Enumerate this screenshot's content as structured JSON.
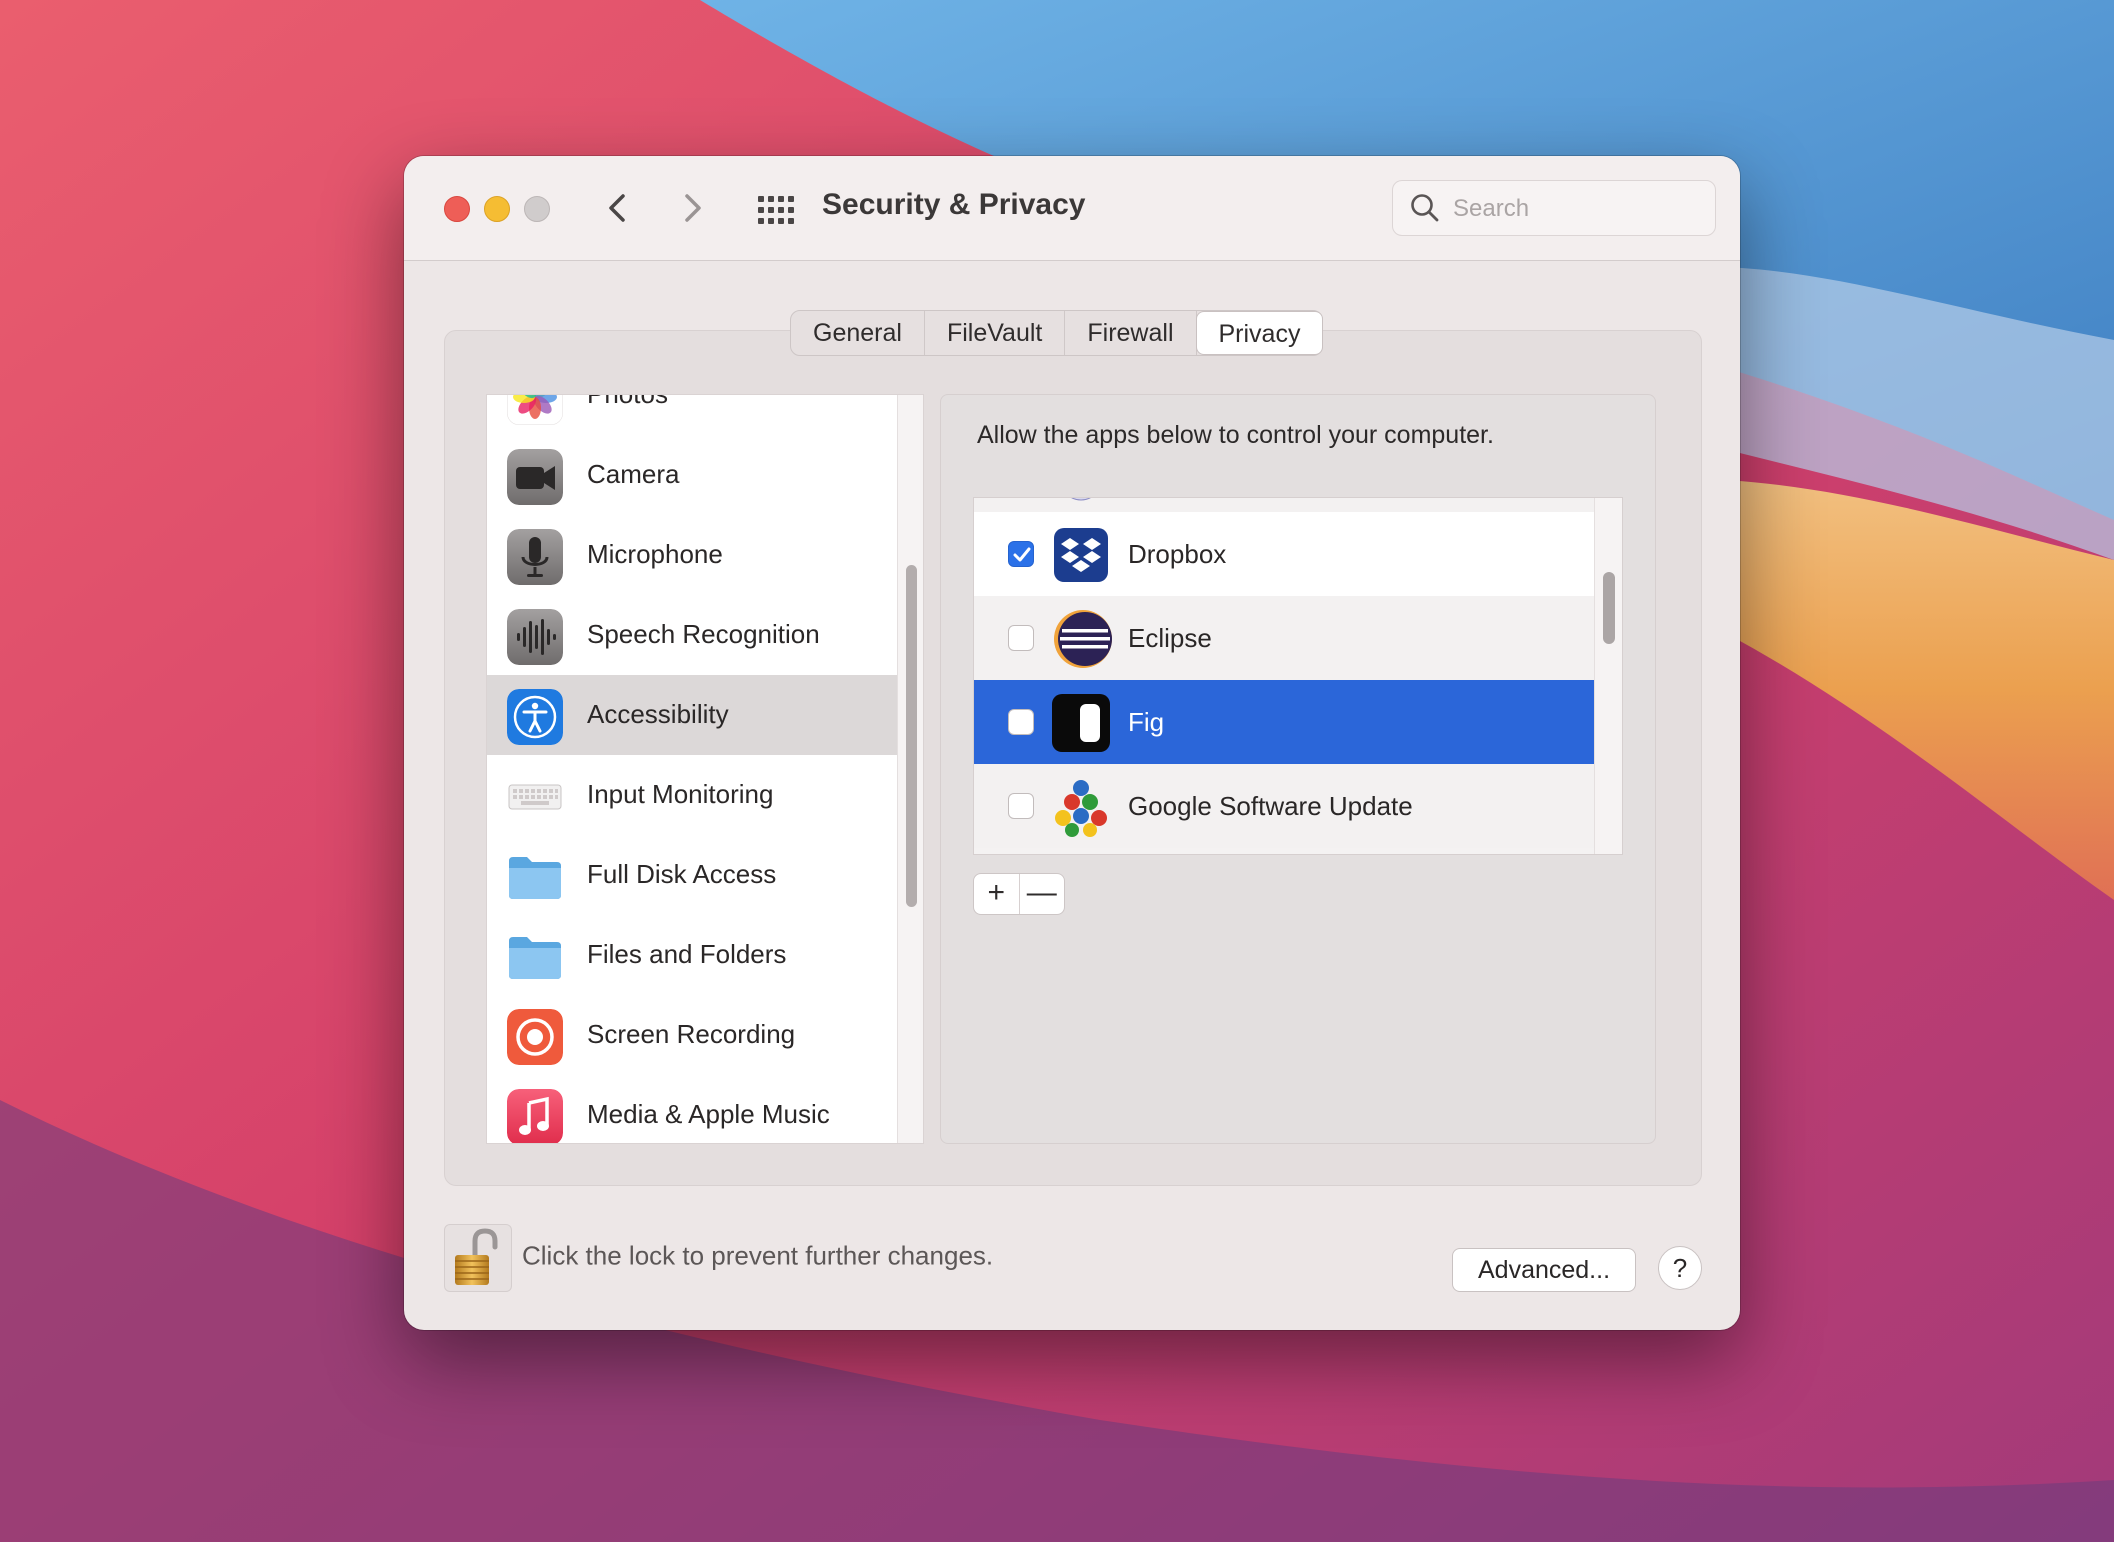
{
  "window": {
    "title": "Security & Privacy",
    "search_placeholder": "Search"
  },
  "tabs": [
    {
      "label": "General"
    },
    {
      "label": "FileVault"
    },
    {
      "label": "Firewall"
    },
    {
      "label": "Privacy",
      "active": true
    }
  ],
  "privacy_categories": [
    {
      "label": "Photos",
      "icon": "photos-icon"
    },
    {
      "label": "Camera",
      "icon": "camera-icon"
    },
    {
      "label": "Microphone",
      "icon": "microphone-icon"
    },
    {
      "label": "Speech Recognition",
      "icon": "speech-recognition-icon"
    },
    {
      "label": "Accessibility",
      "icon": "accessibility-icon",
      "selected": true
    },
    {
      "label": "Input Monitoring",
      "icon": "keyboard-icon"
    },
    {
      "label": "Full Disk Access",
      "icon": "folder-icon"
    },
    {
      "label": "Files and Folders",
      "icon": "folder-icon"
    },
    {
      "label": "Screen Recording",
      "icon": "screen-recording-icon"
    },
    {
      "label": "Media & Apple Music",
      "icon": "music-icon"
    }
  ],
  "accessibility_panel": {
    "description": "Allow the apps below to control your computer.",
    "apps": [
      {
        "name": "Dropbox",
        "checked": true,
        "icon": "dropbox-icon"
      },
      {
        "name": "Eclipse",
        "checked": false,
        "icon": "eclipse-icon"
      },
      {
        "name": "Fig",
        "checked": false,
        "selected": true,
        "icon": "fig-icon"
      },
      {
        "name": "Google Software Update",
        "checked": false,
        "icon": "google-software-update-icon"
      }
    ],
    "add_label": "+",
    "remove_label": "—"
  },
  "footer": {
    "lock_text": "Click the lock to prevent further changes.",
    "advanced_label": "Advanced...",
    "help_label": "?"
  },
  "colors": {
    "selection_blue": "#2b66d9",
    "checkbox_blue": "#2b71e8",
    "window_bg": "#ede7e7"
  }
}
